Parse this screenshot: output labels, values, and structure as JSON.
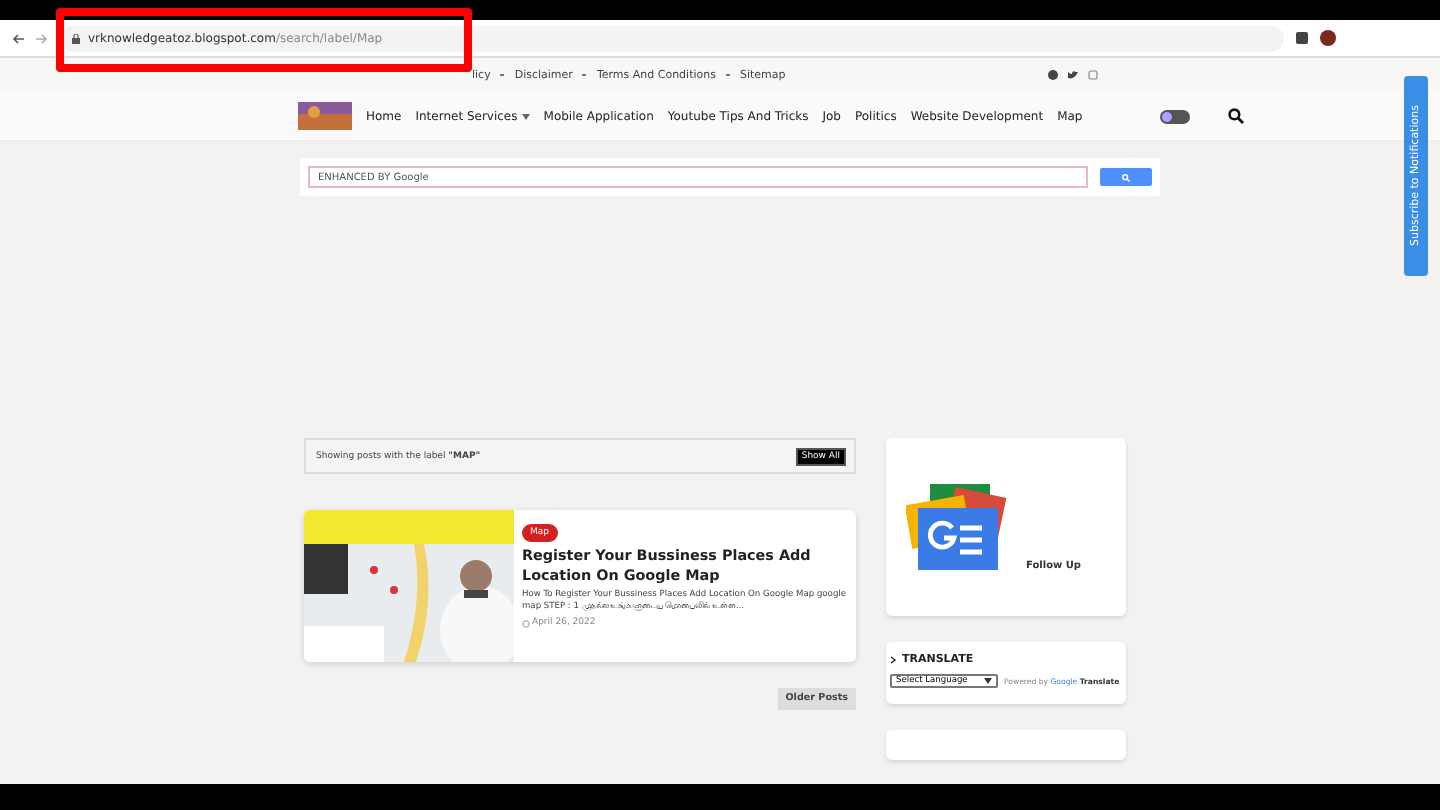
{
  "browser": {
    "url_host": "vrknowledgeatoz.blogspot.com",
    "url_path": "/search/label/Map"
  },
  "top_links": [
    "licy",
    "Disclaimer",
    "Terms And Conditions",
    "Sitemap"
  ],
  "nav": {
    "items": [
      {
        "label": "Home",
        "dropdown": false
      },
      {
        "label": "Internet Services",
        "dropdown": true
      },
      {
        "label": "Mobile Application",
        "dropdown": false
      },
      {
        "label": "Youtube Tips And Tricks",
        "dropdown": false
      },
      {
        "label": "Job",
        "dropdown": false
      },
      {
        "label": "Politics",
        "dropdown": false
      },
      {
        "label": "Website Development",
        "dropdown": false
      },
      {
        "label": "Map",
        "dropdown": false
      }
    ],
    "dark_mode": {
      "on": false
    }
  },
  "search": {
    "placeholder": "ENHANCED BY Google"
  },
  "notice": {
    "text": "Showing posts with the label **\"MAP\"**",
    "button": "Show All"
  },
  "posts": [
    {
      "tag": "Map",
      "title": "Register Your Bussiness Places Add Location On Google Map",
      "snippet": "How To Register Your Bussiness Places Add Location On Google Map google map STEP : 1   முதல்ல உங்களுடைய மொபைலில் உள்ள...",
      "date": "April 26, 2022"
    }
  ],
  "older_button": "Older Posts",
  "follow": {
    "label": "Follow Up"
  },
  "translate": {
    "heading": "TRANSLATE",
    "select": "Select Language",
    "powered_by": "Powered by",
    "google": "Google",
    "translate": "Translate"
  },
  "subscribe_tab": "Subscribe to Notifications"
}
